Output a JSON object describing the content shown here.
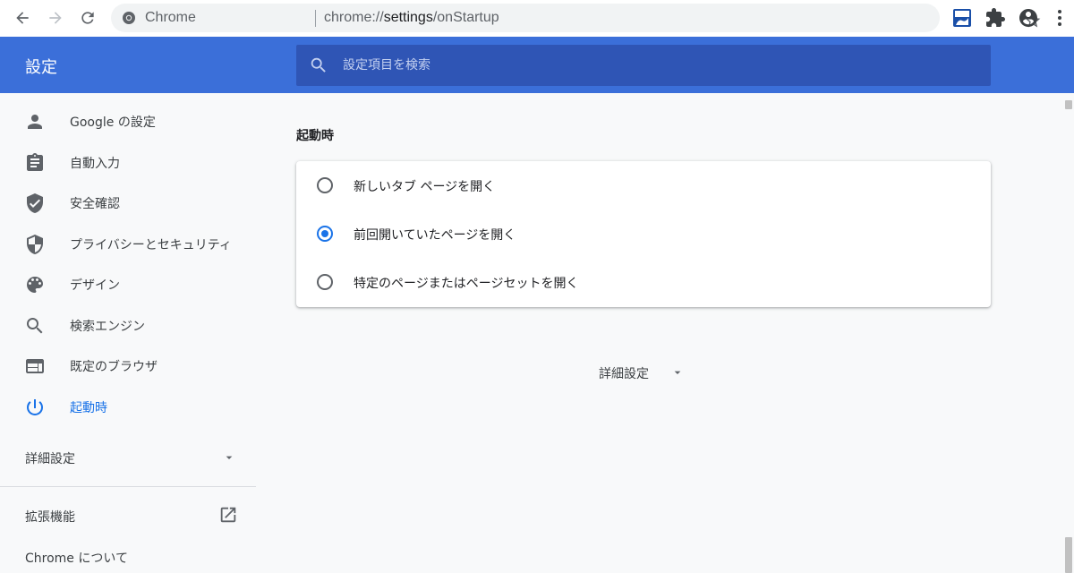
{
  "colors": {
    "header_bg": "#3b6fd9",
    "search_bg": "#2f55b5",
    "accent": "#1a73e8",
    "page_bg": "#f8f9fa",
    "omnibox_bg": "#f1f3f4"
  },
  "browser": {
    "site_name": "Chrome",
    "url_prefix": "chrome://",
    "url_host": "settings",
    "url_path": "/onStartup",
    "icons": [
      "back-icon",
      "forward-icon",
      "reload-icon",
      "star-icon",
      "extension-badge-icon",
      "puzzle-icon",
      "account-icon",
      "more-vert-icon"
    ]
  },
  "header": {
    "title": "設定",
    "search_placeholder": "設定項目を検索"
  },
  "sidebar": {
    "items": [
      {
        "label": "Google の設定",
        "icon": "person-icon"
      },
      {
        "label": "自動入力",
        "icon": "clipboard-icon"
      },
      {
        "label": "安全確認",
        "icon": "shield-check-icon"
      },
      {
        "label": "プライバシーとセキュリティ",
        "icon": "security-shield-icon"
      },
      {
        "label": "デザイン",
        "icon": "palette-icon"
      },
      {
        "label": "検索エンジン",
        "icon": "search-icon"
      },
      {
        "label": "既定のブラウザ",
        "icon": "browser-window-icon"
      },
      {
        "label": "起動時",
        "icon": "power-icon",
        "active": true
      }
    ],
    "advanced_label": "詳細設定",
    "extensions_label": "拡張機能",
    "about_label": "Chrome について"
  },
  "main": {
    "section_title": "起動時",
    "options": [
      {
        "label": "新しいタブ ページを開く",
        "checked": false
      },
      {
        "label": "前回開いていたページを開く",
        "checked": true
      },
      {
        "label": "特定のページまたはページセットを開く",
        "checked": false
      }
    ],
    "advanced_label": "詳細設定"
  }
}
